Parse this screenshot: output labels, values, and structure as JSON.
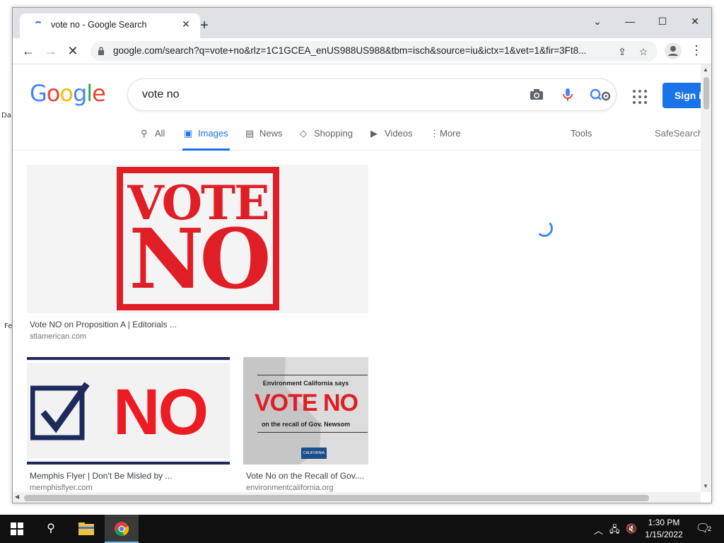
{
  "browser": {
    "tab_title": "vote no - Google Search",
    "new_tab_label": "+",
    "url": "google.com/search?q=vote+no&rlz=1C1GCEA_enUS988US988&tbm=isch&source=iu&ictx=1&vet=1&fir=3Ft8...",
    "window_controls": {
      "collapse": "⌄",
      "minimize": "—",
      "maximize": "☐",
      "close": "✕"
    }
  },
  "search": {
    "query": "vote no",
    "sign_in_label": "Sign in"
  },
  "search_tabs": [
    {
      "label": "All",
      "icon": "search-icon"
    },
    {
      "label": "Images",
      "icon": "image-icon"
    },
    {
      "label": "News",
      "icon": "news-icon"
    },
    {
      "label": "Shopping",
      "icon": "tag-icon"
    },
    {
      "label": "Videos",
      "icon": "play-icon"
    },
    {
      "label": "More",
      "icon": "more-vert-icon"
    }
  ],
  "tools_label": "Tools",
  "safesearch_label": "SafeSearch",
  "results": [
    {
      "title": "Vote NO on Proposition A | Editorials ...",
      "site": "stlamerican.com",
      "image_text": [
        "VOTE",
        "NO"
      ]
    },
    {
      "title": "Memphis Flyer | Don't Be Misled by ...",
      "site": "memphisflyer.com",
      "image_text": [
        "NO"
      ]
    },
    {
      "title": "Vote No on the Recall of Gov....",
      "site": "environmentcalifornia.org",
      "image_text": [
        "Environment California says",
        "VOTE NO",
        "on the recall of Gov. Newsom",
        "CALIFORNIA"
      ]
    }
  ],
  "desktop_fragments": [
    "Da",
    "Fe"
  ],
  "taskbar": {
    "time": "1:30 PM",
    "date": "1/15/2022",
    "notification_count": "2"
  },
  "colors": {
    "google_blue": "#4285F4",
    "google_red": "#EA4335",
    "google_yellow": "#FBBC05",
    "google_green": "#34A853",
    "accent": "#1a73e8",
    "stamp_red": "#e01e26"
  }
}
